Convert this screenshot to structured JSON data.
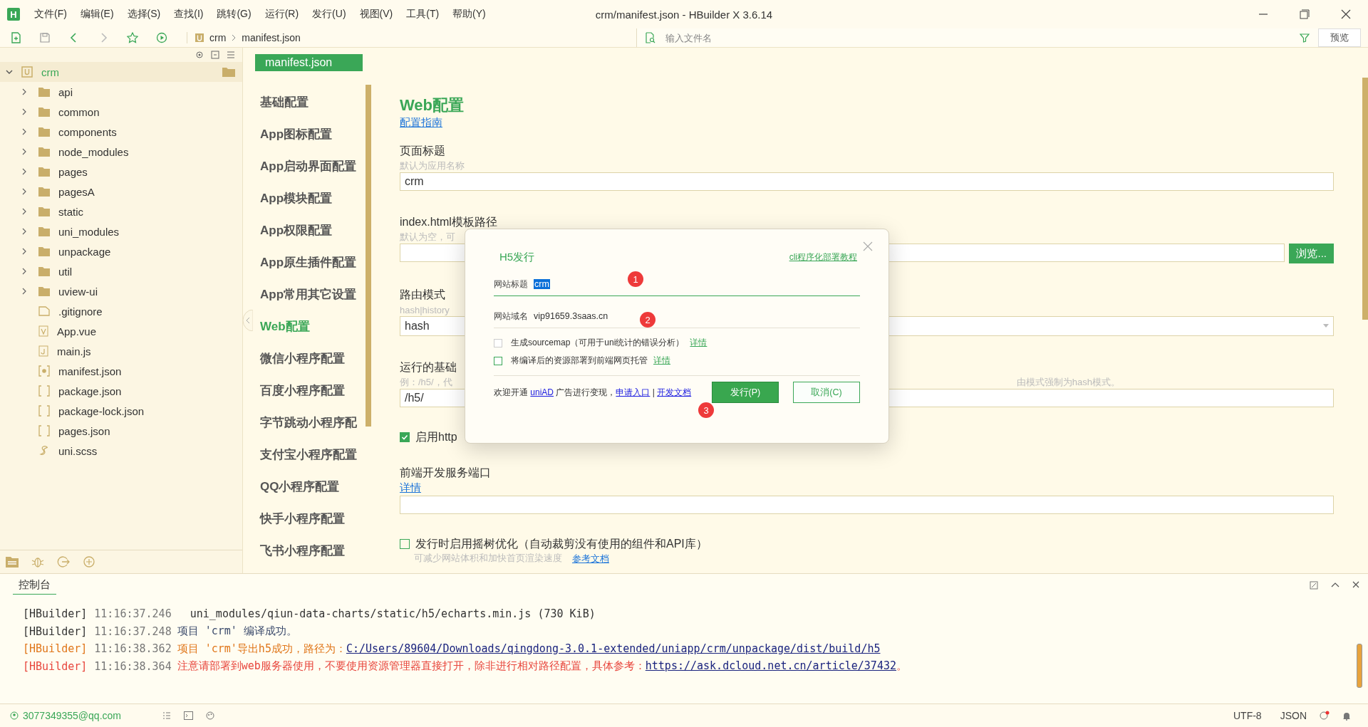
{
  "window": {
    "logo": "H",
    "title": "crm/manifest.json - HBuilder X 3.6.14"
  },
  "menu": [
    "文件(F)",
    "编辑(E)",
    "选择(S)",
    "查找(I)",
    "跳转(G)",
    "运行(R)",
    "发行(U)",
    "视图(V)",
    "工具(T)",
    "帮助(Y)"
  ],
  "toolbar": {
    "breadcrumb": [
      "crm",
      "manifest.json"
    ],
    "search": {
      "placeholder": "输入文件名"
    },
    "preview": "预览"
  },
  "explorer": {
    "project": {
      "name": "crm",
      "expanded": true,
      "selected": true
    },
    "items": [
      {
        "name": "api",
        "kind": "folder"
      },
      {
        "name": "common",
        "kind": "folder"
      },
      {
        "name": "components",
        "kind": "folder"
      },
      {
        "name": "node_modules",
        "kind": "folder"
      },
      {
        "name": "pages",
        "kind": "folder"
      },
      {
        "name": "pagesA",
        "kind": "folder"
      },
      {
        "name": "static",
        "kind": "folder"
      },
      {
        "name": "uni_modules",
        "kind": "folder"
      },
      {
        "name": "unpackage",
        "kind": "folder"
      },
      {
        "name": "util",
        "kind": "folder"
      },
      {
        "name": "uview-ui",
        "kind": "folder"
      },
      {
        "name": ".gitignore",
        "kind": "file"
      },
      {
        "name": "App.vue",
        "kind": "vue"
      },
      {
        "name": "main.js",
        "kind": "js"
      },
      {
        "name": "manifest.json",
        "kind": "manifest"
      },
      {
        "name": "package.json",
        "kind": "json"
      },
      {
        "name": "package-lock.json",
        "kind": "json"
      },
      {
        "name": "pages.json",
        "kind": "json"
      },
      {
        "name": "uni.scss",
        "kind": "scss"
      }
    ]
  },
  "editor_tab": {
    "label": "manifest.json"
  },
  "config_nav": [
    {
      "label": "基础配置",
      "selected": false
    },
    {
      "label": "App图标配置",
      "selected": false
    },
    {
      "label": "App启动界面配置",
      "selected": false
    },
    {
      "label": "App模块配置",
      "selected": false
    },
    {
      "label": "App权限配置",
      "selected": false
    },
    {
      "label": "App原生插件配置",
      "selected": false
    },
    {
      "label": "App常用其它设置",
      "selected": false
    },
    {
      "label": "Web配置",
      "selected": true
    },
    {
      "label": "微信小程序配置",
      "selected": false
    },
    {
      "label": "百度小程序配置",
      "selected": false
    },
    {
      "label": "字节跳动小程序配",
      "selected": false
    },
    {
      "label": "支付宝小程序配置",
      "selected": false
    },
    {
      "label": "QQ小程序配置",
      "selected": false
    },
    {
      "label": "快手小程序配置",
      "selected": false
    },
    {
      "label": "飞书小程序配置",
      "selected": false
    }
  ],
  "form": {
    "heading": "Web配置",
    "guide_link": "配置指南",
    "fields": [
      {
        "kind": "text",
        "label": "页面标题",
        "hint": "默认为应用名称",
        "value": "crm"
      },
      {
        "kind": "browse",
        "label": "index.html模板路径",
        "hint": "默认为空，可",
        "button": "浏览..."
      },
      {
        "kind": "select",
        "label": "路由模式",
        "hint": "hash|history",
        "value": "hash"
      },
      {
        "kind": "text",
        "label": "运行的基础",
        "hint": "例：/h5/，代",
        "hint_right": "由模式强制为hash模式。",
        "value": "/h5/"
      },
      {
        "kind": "checkbox",
        "label": "启用http",
        "checked": true
      },
      {
        "kind": "text",
        "label": "前端开发服务端口",
        "link": "详情"
      },
      {
        "kind": "checkbox",
        "label": "发行时启用摇树优化（自动裁剪没有使用的组件和API库）",
        "checked": false,
        "hint": "可减少网站体积和加快首页渲染速度",
        "link": "参考文档"
      }
    ]
  },
  "dialog": {
    "title": "H5发行",
    "link": "cli程序化部署教程",
    "fields": [
      {
        "label": "网站标题",
        "value": "crm",
        "focused": true,
        "marker": "1"
      },
      {
        "label": "网站域名",
        "value": "vip91659.3saas.cn",
        "focused": false,
        "marker": "2"
      }
    ],
    "options": [
      {
        "label": "生成sourcemap（可用于uni统计的错误分析）",
        "link": "详情",
        "checked": false
      },
      {
        "label": "将编译后的资源部署到前端网页托管",
        "link": "详情",
        "checked": false
      }
    ],
    "footer": {
      "text_1": "欢迎开通 ",
      "link_1": "uniAD",
      "text_2": " 广告进行变现，",
      "link_2": "申请入口",
      "separator": " | ",
      "link_3": "开发文档"
    },
    "buttons": [
      {
        "label": "发行(P)",
        "kind": "primary"
      },
      {
        "label": "取消(C)",
        "kind": "secondary"
      }
    ],
    "footer_marker": "3"
  },
  "console": {
    "title": "控制台",
    "lines": [
      {
        "tag": "[HBuilder]",
        "time": "11:16:37.246",
        "text": "  uni_modules/qiun-data-charts/static/h5/echarts.min.js (730 KiB)",
        "kind": "info"
      },
      {
        "tag": "[HBuilder]",
        "time": "11:16:37.248",
        "text": "项目 'crm' 编译成功。",
        "kind": "success"
      },
      {
        "tag": "[HBuilder]",
        "time": "11:16:38.362",
        "text": "项目 'crm'导出h5成功，路径为：",
        "link": "C:/Users/89604/Downloads/qingdong-3.0.1-extended/uniapp/crm/unpackage/dist/build/h5",
        "kind": "warning"
      },
      {
        "tag": "[HBuilder]",
        "time": "11:16:38.364",
        "text": "注意请部署到web服务器使用，不要使用资源管理器直接打开，除非进行相对路径配置，具体参考：",
        "link": "https://ask.dcloud.net.cn/article/37432",
        "after": "。",
        "kind": "error"
      }
    ]
  },
  "status_bar": {
    "user": "3077349355@qq.com",
    "encoding": "UTF-8",
    "language": "JSON"
  }
}
